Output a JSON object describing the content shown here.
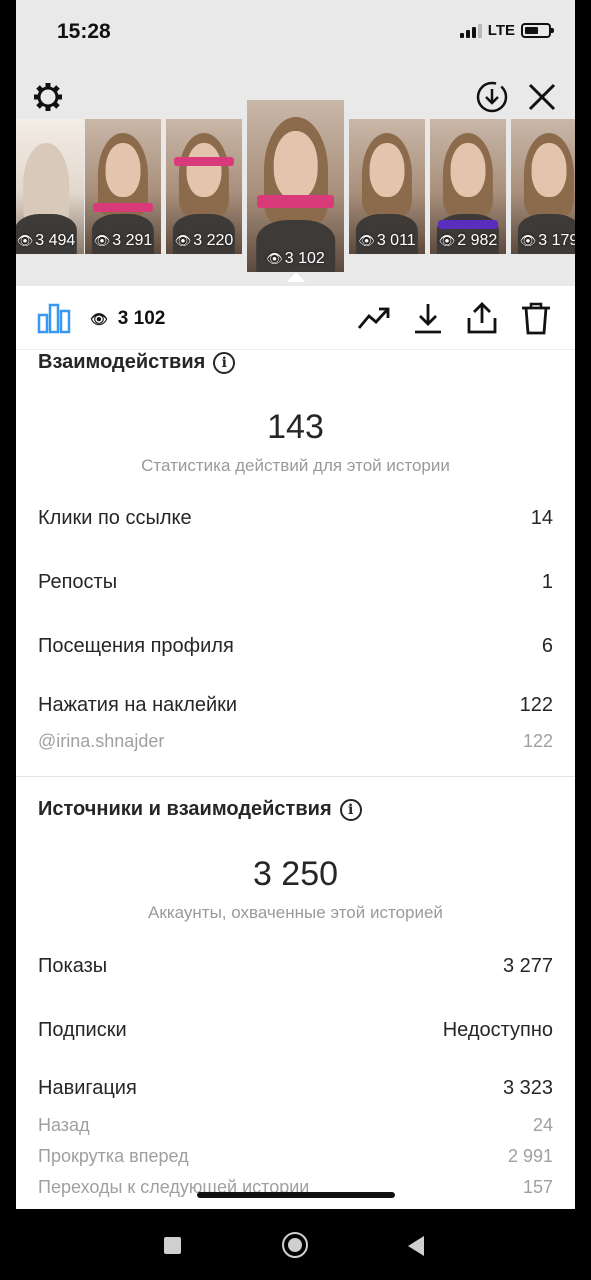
{
  "status_bar": {
    "time": "15:28",
    "network": "LTE"
  },
  "stories": [
    {
      "views": "3 494"
    },
    {
      "views": "3 291"
    },
    {
      "views": "3 220"
    },
    {
      "views": "3 102",
      "current": true
    },
    {
      "views": "3 011"
    },
    {
      "views": "2 982"
    },
    {
      "views": "3 179"
    }
  ],
  "toolbar": {
    "views": "3 102"
  },
  "interactions": {
    "title": "Взаимодействия",
    "total": "143",
    "subtitle": "Статистика действий для этой истории",
    "rows": [
      {
        "label": "Клики по ссылке",
        "value": "14"
      },
      {
        "label": "Репосты",
        "value": "1"
      },
      {
        "label": "Посещения профиля",
        "value": "6"
      },
      {
        "label": "Нажатия на наклейки",
        "value": "122"
      }
    ],
    "sticker_row": {
      "label": "@irina.shnajder",
      "value": "122"
    }
  },
  "discovery": {
    "title": "Источники и взаимодействия",
    "total": "3 250",
    "subtitle": "Аккаунты, охваченные этой историей",
    "rows": [
      {
        "label": "Показы",
        "value": "3 277"
      },
      {
        "label": "Подписки",
        "value": "Недоступно"
      },
      {
        "label": "Навигация",
        "value": "3 323"
      }
    ],
    "nav_rows": [
      {
        "label": "Назад",
        "value": "24"
      },
      {
        "label": "Прокрутка вперед",
        "value": "2 991"
      },
      {
        "label": "Переходы к следующей истории",
        "value": "157"
      }
    ]
  },
  "icons": [
    "settings-icon",
    "download-circle-icon",
    "close-icon",
    "insights-icon",
    "eye-icon",
    "trend-icon",
    "download-icon",
    "share-icon",
    "trash-icon"
  ]
}
